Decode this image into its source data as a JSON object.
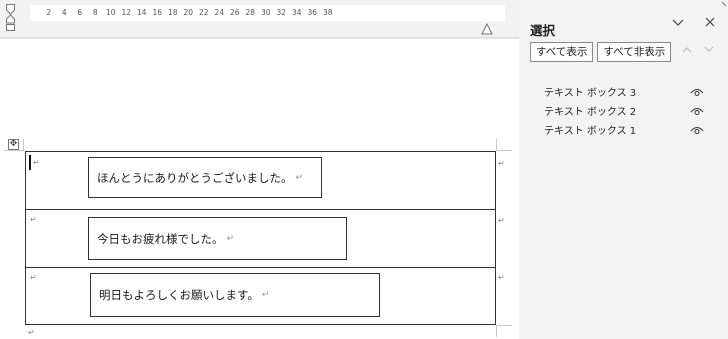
{
  "ruler": {
    "numbers": [
      "2",
      "4",
      "6",
      "8",
      "10",
      "12",
      "14",
      "16",
      "18",
      "20",
      "22",
      "24",
      "26",
      "28",
      "30",
      "32",
      "34",
      "36",
      "38"
    ]
  },
  "document": {
    "rows": [
      {
        "textbox_text": "ほんとうにありがとうございました。"
      },
      {
        "textbox_text": "今日もお疲れ様でした。"
      },
      {
        "textbox_text": "明日もよろしくお願いします。"
      }
    ],
    "return_mark": "↵",
    "move_handle_glyph": "✥"
  },
  "selection_pane": {
    "title": "選択",
    "collapse_icon": "chevron-down-icon",
    "close_icon": "close-icon",
    "show_all_label": "すべて表示",
    "hide_all_label": "すべて非表示",
    "bring_forward_icon": "chevron-up-icon",
    "send_backward_icon": "chevron-down-icon",
    "items": [
      {
        "label": "テキスト ボックス 3",
        "visible": true
      },
      {
        "label": "テキスト ボックス 2",
        "visible": true
      },
      {
        "label": "テキスト ボックス 1",
        "visible": true
      }
    ]
  }
}
